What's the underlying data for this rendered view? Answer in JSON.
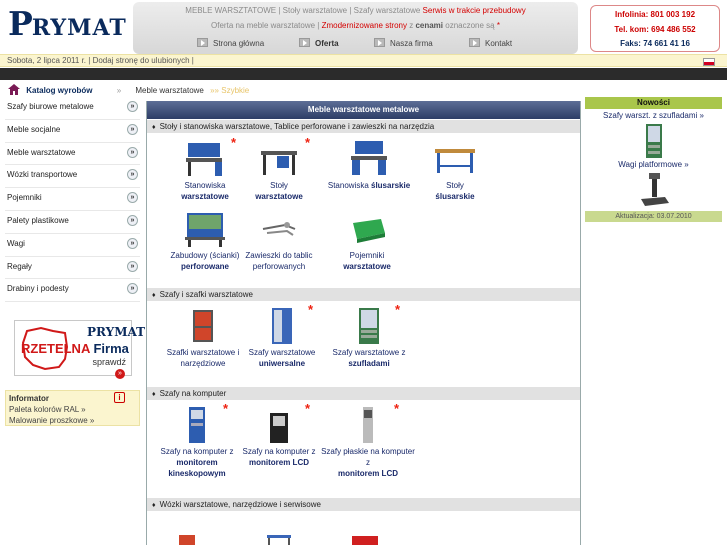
{
  "logo": {
    "text_big": "P",
    "text_small": "RYMAT"
  },
  "header": {
    "line1_parts": [
      "MEBLE WARSZTATOWE | Stoły warsztatowe | Szafy warsztatowe ",
      "Serwis w trakcie przebudowy"
    ],
    "line2_parts": [
      "Oferta na meble warsztatowe | ",
      "Zmodernizowane strony",
      " z ",
      "cenami",
      " oznaczone są ",
      "*"
    ],
    "nav": [
      {
        "label": "Strona główna"
      },
      {
        "label": "Oferta"
      },
      {
        "label": "Nasza firma"
      },
      {
        "label": "Kontakt"
      }
    ]
  },
  "contact": {
    "infolinia_label": "Infolinia:",
    "infolinia": "801 003 192",
    "telkom_label": "Tel. kom:",
    "telkom": "694 486 552",
    "faks_label": "Faks:",
    "faks": "74 661 41 16"
  },
  "datebar": {
    "date": "Sobota, 2 lipca 2011 r.",
    "sep": " | ",
    "fav": "Dodaj stronę do ulubionych",
    "end": " |"
  },
  "breadcrumb": {
    "catalog": "Katalog wyrobów",
    "sep": "»",
    "current": "Meble warsztatowe",
    "faded": "»» Szybkie"
  },
  "sidebar": {
    "items": [
      {
        "label": "Szafy biurowe metalowe"
      },
      {
        "label": "Meble socjalne"
      },
      {
        "label": "Meble warsztatowe"
      },
      {
        "label": "Wózki transportowe"
      },
      {
        "label": "Pojemniki"
      },
      {
        "label": "Palety plastikowe"
      },
      {
        "label": "Wagi"
      },
      {
        "label": "Regały"
      },
      {
        "label": "Drabiny i podesty"
      }
    ],
    "chevron": "»"
  },
  "badge": {
    "prymat": "PRYMAT",
    "rzetelna": "RZETELNA",
    "firma": "Firma",
    "sprawdz": "sprawdź",
    "go": "»"
  },
  "informator": {
    "title": "Informator",
    "icon": "i",
    "links": [
      "Paleta kolorów RAL »",
      "Malowanie proszkowe »"
    ]
  },
  "main": {
    "title": "Meble warsztatowe metalowe",
    "sections": [
      {
        "title": "Stoły i stanowiska warsztatowe, Tablice perforowane i zawieszki na narzędzia"
      },
      {
        "title": "Szafy i szafki warsztatowe"
      },
      {
        "title": "Szafy na komputer"
      },
      {
        "title": "Wózki warsztatowe, narzędziowe i serwisowe"
      }
    ],
    "products": [
      {
        "l1": "Stanowiska",
        "l2": "warsztatowe",
        "star": "*"
      },
      {
        "l1": "Stoły",
        "l2": "warsztatowe",
        "star": "*"
      },
      {
        "l1": "Stanowiska ",
        "l2": "ślusarskie",
        "star": ""
      },
      {
        "l1": "Stoły",
        "l2": "ślusarskie",
        "star": ""
      },
      {
        "l1": "Zabudowy (ścianki)",
        "l2": "perforowane",
        "star": ""
      },
      {
        "l1": "Zawieszki do tablic",
        "l2": "perforowanych",
        "star": ""
      },
      {
        "l1": "Pojemniki",
        "l2": "warsztatowe",
        "star": ""
      },
      {
        "l1": "Szafki warsztatowe i",
        "l2": "narzędziowe",
        "star": ""
      },
      {
        "l1": "Szafy warsztatowe",
        "l2": "uniwersalne",
        "star": "*"
      },
      {
        "l1": "Szafy warsztatowe z",
        "l2": "szufladami",
        "star": "*"
      },
      {
        "l1": "Szafy na komputer z",
        "l2": "monitorem",
        "l3": "kineskopowym",
        "star": "*"
      },
      {
        "l1": "Szafy na komputer z",
        "l2": "monitorem LCD",
        "star": "*"
      },
      {
        "l1": "Szafy płaskie na komputer z",
        "l2": "monitorem LCD",
        "star": "*"
      }
    ]
  },
  "right": {
    "title": "Nowości",
    "link1": "Szafy warszt. z szufladami »",
    "link2": "Wagi platformowe »",
    "update": "Aktualizacja: 03.07.2010"
  }
}
